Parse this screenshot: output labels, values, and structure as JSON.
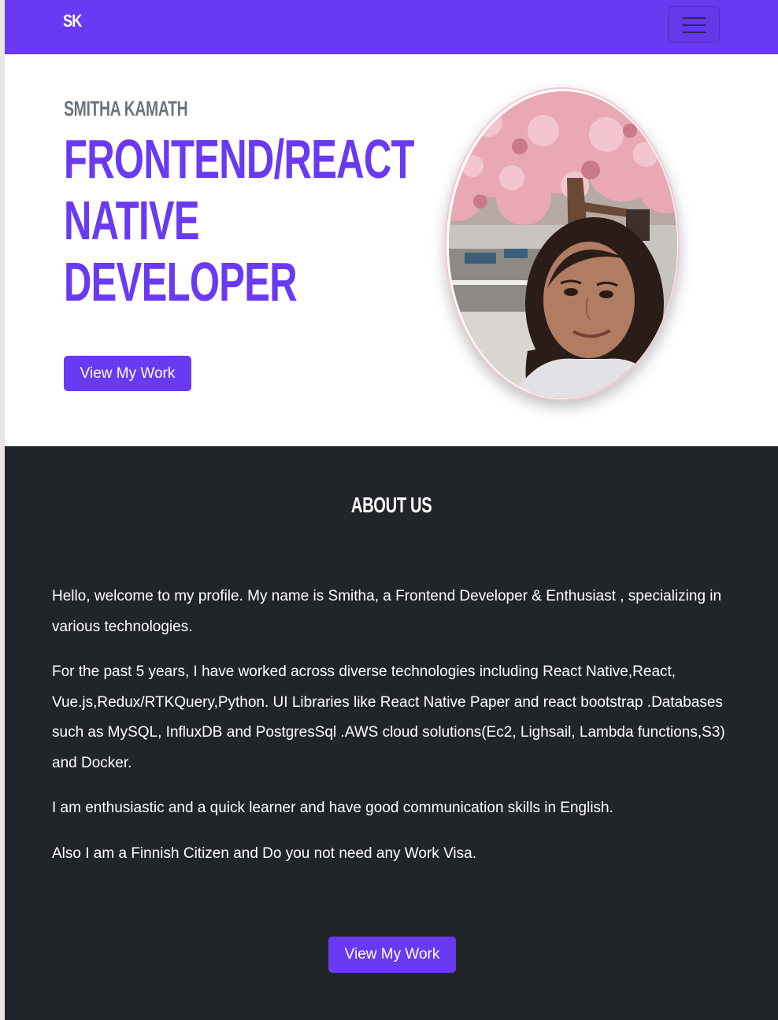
{
  "navbar": {
    "brand": "SK",
    "toggle_icon": "hamburger-menu-icon",
    "color": "#6a3af2"
  },
  "hero": {
    "name": "SMITHA KAMATH",
    "headline_lines": [
      "FRONTEND/REACT",
      "NATIVE",
      "DEVELOPER"
    ],
    "button_label": "View My Work",
    "portrait": "profile-photo"
  },
  "about": {
    "title": "ABOUT US",
    "paragraphs": [
      "Hello, welcome to my profile. My name is Smitha, a Frontend Developer & Enthusiast , specializing in various technologies.",
      "For the past 5 years, I have worked across diverse technologies including React Native,React, Vue.js,Redux/RTKQuery,Python. UI Libraries like React Native Paper and react bootstrap .Databases such as MySQL, InfluxDB and PostgresSql .AWS cloud solutions(Ec2, Lighsail, Lambda functions,S3) and Docker.",
      "I am enthusiastic and a quick learner and have good communication skills in English.",
      "Also I am a Finnish Citizen and Do you not need any Work Visa."
    ],
    "button_label": "View My Work",
    "background": "#212529"
  }
}
